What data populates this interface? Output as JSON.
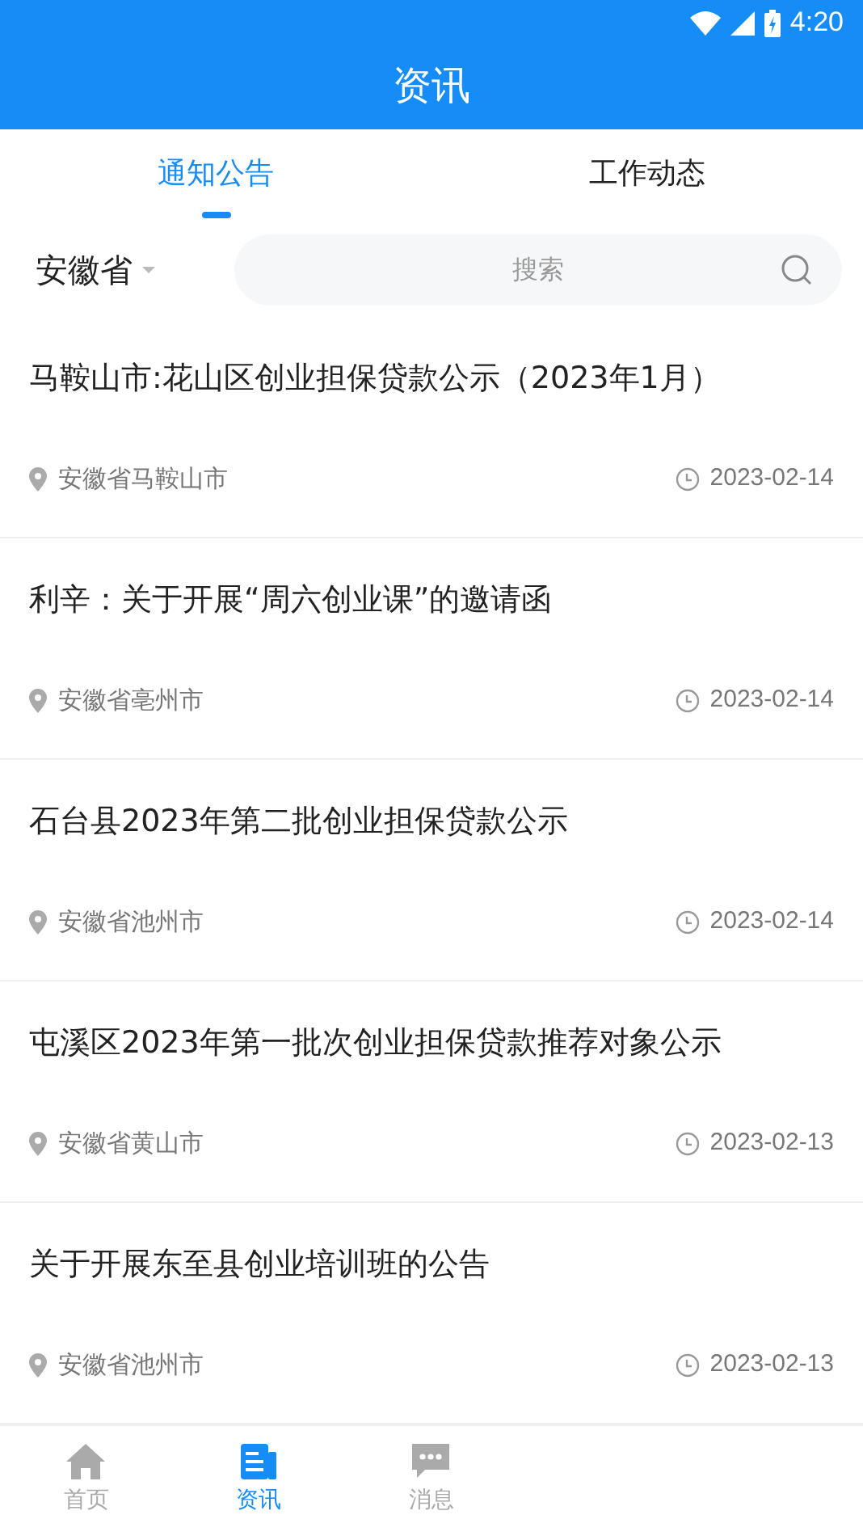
{
  "status_bar": {
    "time": "4:20"
  },
  "header": {
    "title": "资讯"
  },
  "tabs": [
    {
      "label": "通知公告",
      "selected": true
    },
    {
      "label": "工作动态",
      "selected": false
    }
  ],
  "filter": {
    "region": "安徽省",
    "search_placeholder": "搜索"
  },
  "articles": [
    {
      "title": "马鞍山市:花山区创业担保贷款公示（2023年1月）",
      "location": "安徽省马鞍山市",
      "date": "2023-02-14"
    },
    {
      "title": "利辛：关于开展“周六创业课”的邀请函",
      "location": "安徽省亳州市",
      "date": "2023-02-14"
    },
    {
      "title": "石台县2023年第二批创业担保贷款公示",
      "location": "安徽省池州市",
      "date": "2023-02-14"
    },
    {
      "title": "屯溪区2023年第一批次创业担保贷款推荐对象公示",
      "location": "安徽省黄山市",
      "date": "2023-02-13"
    },
    {
      "title": "关于开展东至县创业培训班的公告",
      "location": "安徽省池州市",
      "date": "2023-02-13"
    }
  ],
  "bottom_nav": [
    {
      "kind": "home",
      "label": "首页",
      "selected": false
    },
    {
      "kind": "news",
      "label": "资讯",
      "selected": true
    },
    {
      "kind": "message",
      "label": "消息",
      "selected": false
    }
  ]
}
